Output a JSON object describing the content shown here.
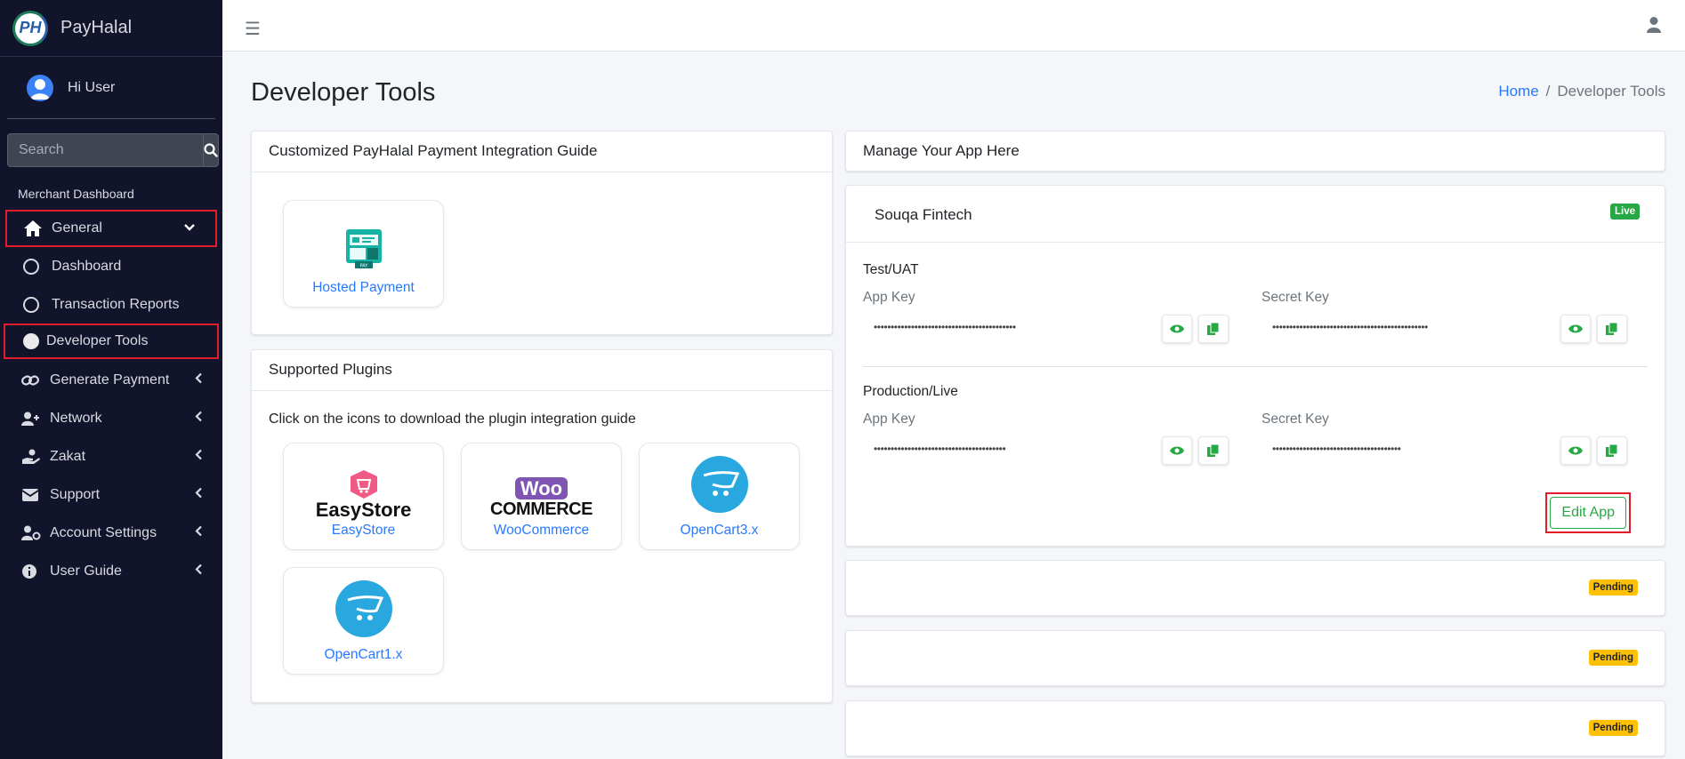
{
  "brand": {
    "logo_text": "PH",
    "name": "PayHalal"
  },
  "user": {
    "greeting": "Hi User"
  },
  "search": {
    "placeholder": "Search"
  },
  "nav": {
    "header": "Merchant Dashboard",
    "general": "General",
    "dashboard": "Dashboard",
    "transaction_reports": "Transaction Reports",
    "developer_tools": "Developer Tools",
    "generate_payment": "Generate Payment",
    "network": "Network",
    "zakat": "Zakat",
    "support": "Support",
    "account_settings": "Account Settings",
    "user_guide": "User Guide"
  },
  "page": {
    "title": "Developer Tools",
    "breadcrumb": {
      "home": "Home",
      "sep": "/",
      "current": "Developer Tools"
    }
  },
  "integration_card": {
    "title": "Customized PayHalal Payment Integration Guide",
    "tiles": [
      {
        "label": "Hosted Payment",
        "icon": "hosted-payment-icon"
      }
    ]
  },
  "plugins_card": {
    "title": "Supported Plugins",
    "hint": "Click on the icons to download the plugin integration guide",
    "tiles": [
      {
        "label": "EasyStore",
        "logo_text": "EasyStore"
      },
      {
        "label": "WooCommerce",
        "logo_top": "Woo",
        "logo_bottom": "COMMERCE"
      },
      {
        "label": "OpenCart3.x"
      },
      {
        "label": "OpenCart1.x"
      }
    ]
  },
  "apps_header": {
    "title": "Manage Your App Here"
  },
  "app": {
    "name": "Souqa Fintech",
    "status": "Live",
    "test": {
      "label": "Test/UAT",
      "app_key_label": "App Key",
      "app_key_value": "••••••••••••••••••••••••••••••••••••••••••",
      "secret_key_label": "Secret Key",
      "secret_key_value": "••••••••••••••••••••••••••••••••••••••••••••••"
    },
    "production": {
      "label": "Production/Live",
      "app_key_label": "App Key",
      "app_key_value": "•••••••••••••••••••••••••••••••••••••••",
      "secret_key_label": "Secret Key",
      "secret_key_value": "••••••••••••••••••••••••••••••••••••••"
    },
    "edit_label": "Edit App"
  },
  "pending_apps": [
    {
      "status": "Pending"
    },
    {
      "status": "Pending"
    },
    {
      "status": "Pending"
    }
  ],
  "colors": {
    "sidebar_bg": "#11142b",
    "accent_green": "#28a745",
    "link_blue": "#2979ff",
    "highlight_red": "#e11d2a",
    "pending_yellow": "#ffc107"
  }
}
